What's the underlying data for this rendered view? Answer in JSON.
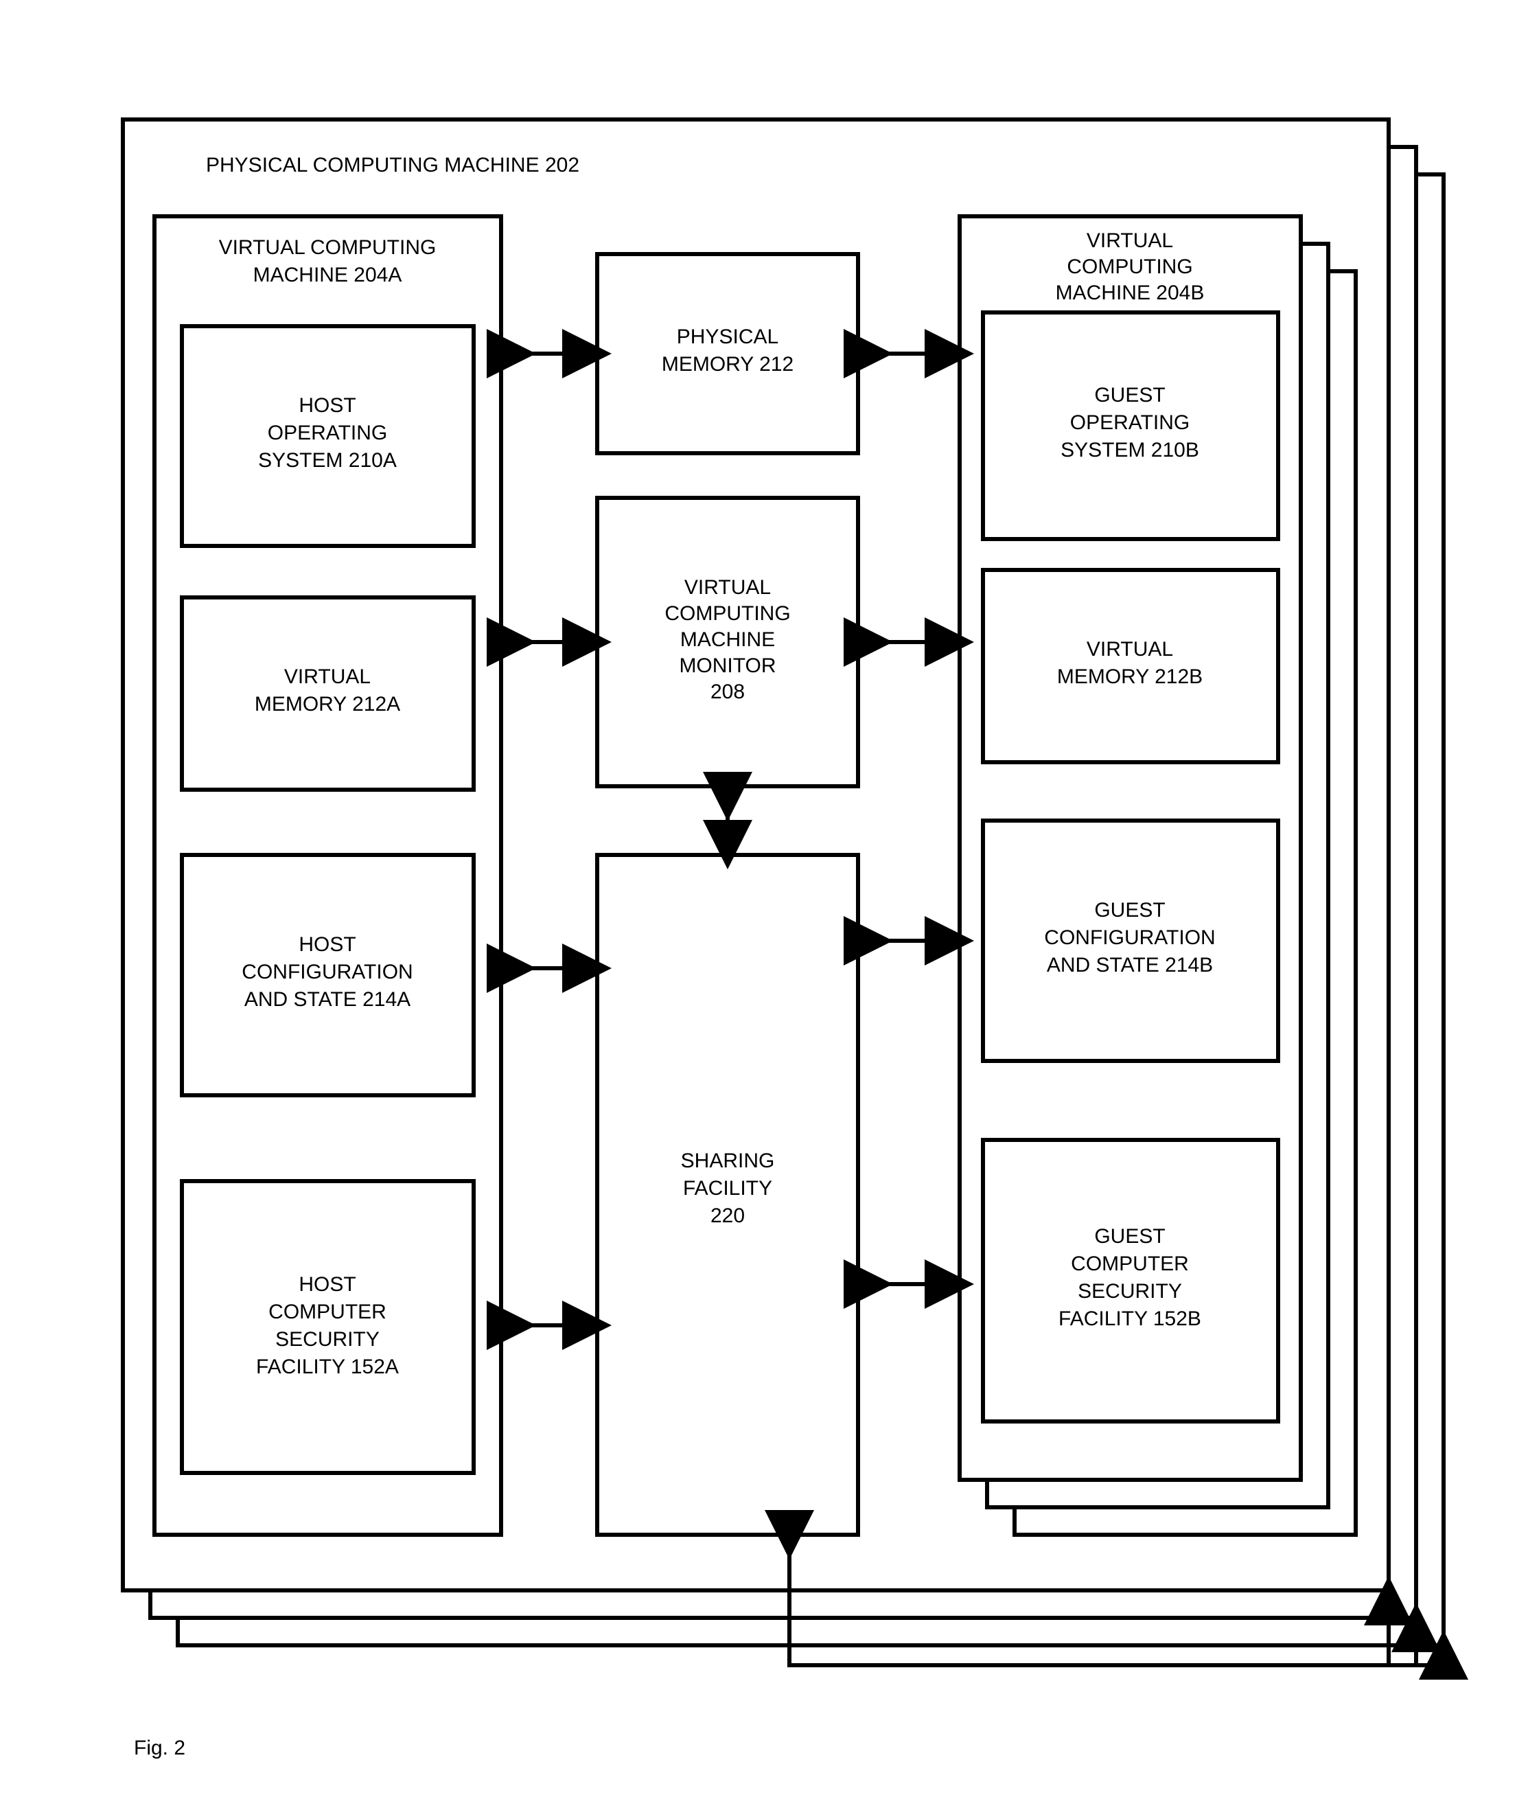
{
  "figure_label": "Fig. 2",
  "outer": {
    "title": "PHYSICAL COMPUTING MACHINE  202"
  },
  "left": {
    "title1": "VIRTUAL COMPUTING",
    "title2": "MACHINE 204A",
    "os1": "HOST",
    "os2": "OPERATING",
    "os3": "SYSTEM 210A",
    "mem1": "VIRTUAL",
    "mem2": "MEMORY 212A",
    "cfg1": "HOST",
    "cfg2": "CONFIGURATION",
    "cfg3": "AND STATE 214A",
    "sec1": "HOST",
    "sec2": "COMPUTER",
    "sec3": "SECURITY",
    "sec4": "FACILITY 152A"
  },
  "right": {
    "title1": "VIRTUAL",
    "title2": "COMPUTING",
    "title3": "MACHINE 204B",
    "os1": "GUEST",
    "os2": "OPERATING",
    "os3": "SYSTEM 210B",
    "mem1": "VIRTUAL",
    "mem2": "MEMORY 212B",
    "cfg1": "GUEST",
    "cfg2": "CONFIGURATION",
    "cfg3": "AND STATE 214B",
    "sec1": "GUEST",
    "sec2": "COMPUTER",
    "sec3": "SECURITY",
    "sec4": "FACILITY 152B"
  },
  "center": {
    "pm1": "PHYSICAL",
    "pm2": "MEMORY 212",
    "mon1": "VIRTUAL",
    "mon2": "COMPUTING",
    "mon3": "MACHINE",
    "mon4": "MONITOR",
    "mon5": "208",
    "sh1": "SHARING",
    "sh2": "FACILITY",
    "sh3": "220"
  }
}
